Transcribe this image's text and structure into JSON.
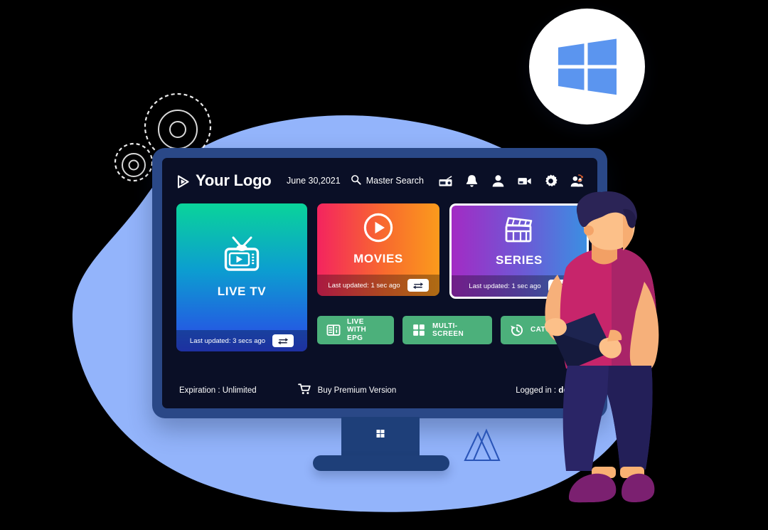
{
  "platform_badge": {
    "icon": "windows-logo-icon",
    "name": "Windows"
  },
  "app": {
    "header": {
      "logo_text": "Your Logo",
      "logo_icon": "play-outline-icon",
      "date": "June 30,2021",
      "search_label": "Master Search",
      "search_icon": "search-icon",
      "icons": [
        {
          "name": "radio-icon",
          "label": "Radio"
        },
        {
          "name": "bell-icon",
          "label": "Notifications"
        },
        {
          "name": "user-icon",
          "label": "Account"
        },
        {
          "name": "video-camera-icon",
          "label": "Recordings"
        },
        {
          "name": "gear-icon",
          "label": "Settings"
        },
        {
          "name": "switch-user-icon",
          "label": "Switch User"
        }
      ]
    },
    "cards": [
      {
        "id": "live-tv",
        "title": "LIVE TV",
        "icon": "television-icon",
        "last_updated": "Last updated: 3 secs ago",
        "refresh_icon": "refresh-icon",
        "gradient_from": "#0ad49a",
        "gradient_to": "#2b46e8",
        "selected": false
      },
      {
        "id": "movies",
        "title": "MOVIES",
        "icon": "play-circle-icon",
        "last_updated": "Last updated: 1 sec ago",
        "refresh_icon": "refresh-icon",
        "gradient_from": "#f4245f",
        "gradient_to": "#fb9b1c",
        "selected": false
      },
      {
        "id": "series",
        "title": "SERIES",
        "icon": "clapperboard-icon",
        "last_updated": "Last updated: 1 sec ago",
        "refresh_icon": "refresh-icon",
        "gradient_from": "#a32bc4",
        "gradient_to": "#3b8fe2",
        "selected": true
      }
    ],
    "quick_actions": [
      {
        "id": "live-with-epg",
        "line1": "LIVE WITH",
        "line2": "EPG",
        "icon": "epg-book-icon"
      },
      {
        "id": "multi-screen",
        "line1": "MULTI-SCREEN",
        "line2": "",
        "icon": "grid-icon"
      },
      {
        "id": "catch-up",
        "line1": "CATCH UP",
        "line2": "",
        "icon": "clock-rewind-icon"
      }
    ],
    "footer": {
      "expiration": "Expiration : Unlimited",
      "buy_label": "Buy Premium Version",
      "buy_icon": "cart-icon",
      "logged_in_label": "Logged in : ",
      "logged_in_user": "demo"
    },
    "colors": {
      "screen_bg": "#0a0f26",
      "bezel": "#2a4887",
      "quick_action": "#4cb07b",
      "blob": "#93b4fb"
    }
  },
  "decorations": {
    "gears": "dashed-gear-outline-decoration",
    "triangles": "triangle-outline-decoration",
    "stand_mark": "windows-grid-mark"
  }
}
